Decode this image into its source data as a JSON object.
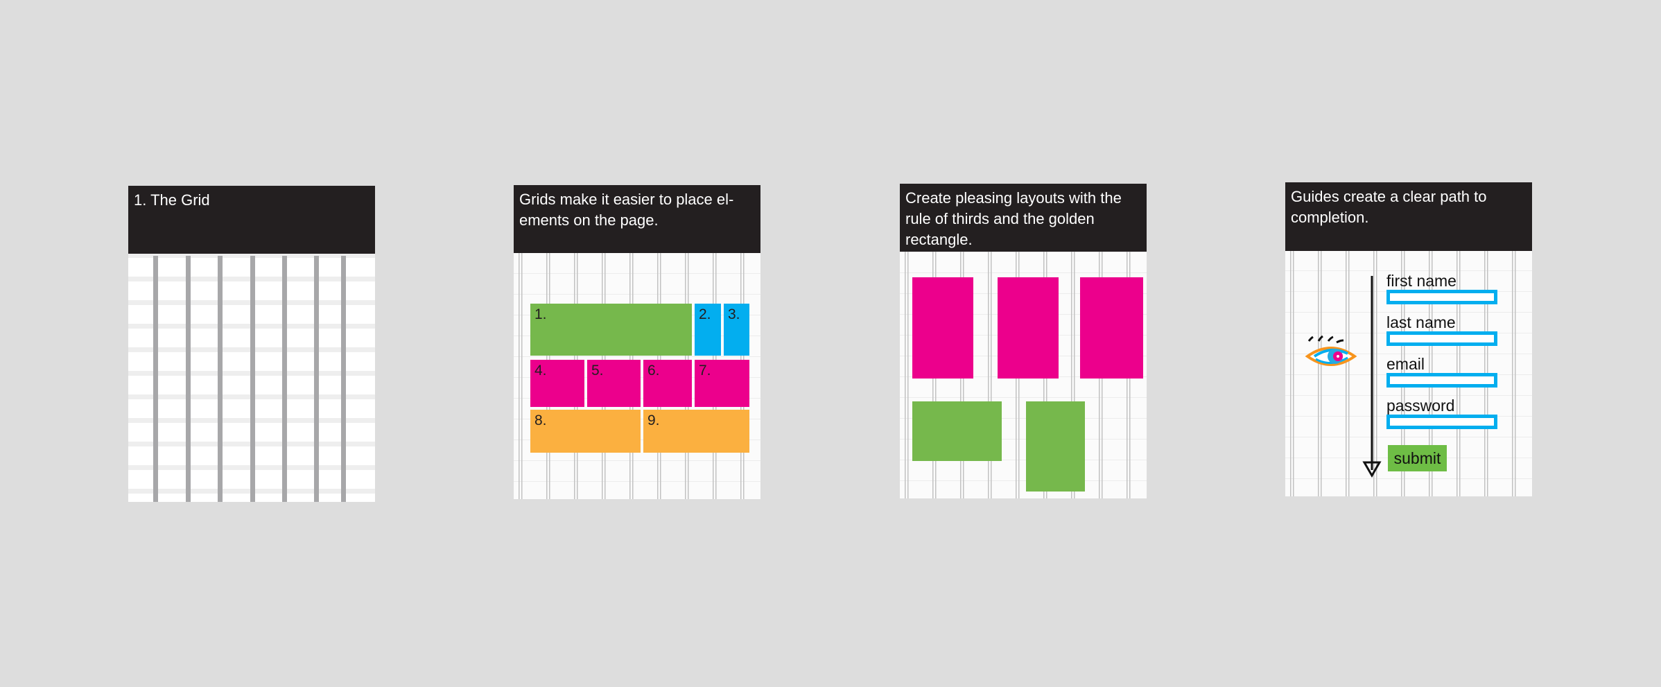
{
  "cards": [
    {
      "title": "1. The Grid"
    },
    {
      "title": "Grids make it easier to place el-ements on the page.",
      "blocks": [
        {
          "label": "1.",
          "color": "green"
        },
        {
          "label": "2.",
          "color": "blue"
        },
        {
          "label": "3.",
          "color": "blue"
        },
        {
          "label": "4.",
          "color": "magenta"
        },
        {
          "label": "5.",
          "color": "magenta"
        },
        {
          "label": "6.",
          "color": "magenta"
        },
        {
          "label": "7.",
          "color": "magenta"
        },
        {
          "label": "8.",
          "color": "orange"
        },
        {
          "label": "9.",
          "color": "orange"
        }
      ]
    },
    {
      "title": "Create pleasing layouts with the rule of thirds and the golden rectangle."
    },
    {
      "title": "Guides create a clear path to completion.",
      "form": {
        "first_name_label": "first name",
        "last_name_label": "last name",
        "email_label": "email",
        "password_label": "password",
        "submit_label": "submit"
      },
      "icon": "eye-icon"
    }
  ],
  "colors": {
    "background": "#dddddd",
    "header": "#231f20",
    "green": "#76b84c",
    "blue": "#03aeef",
    "magenta": "#ec008c",
    "orange": "#fbb040",
    "column": "#a7a7a9"
  }
}
